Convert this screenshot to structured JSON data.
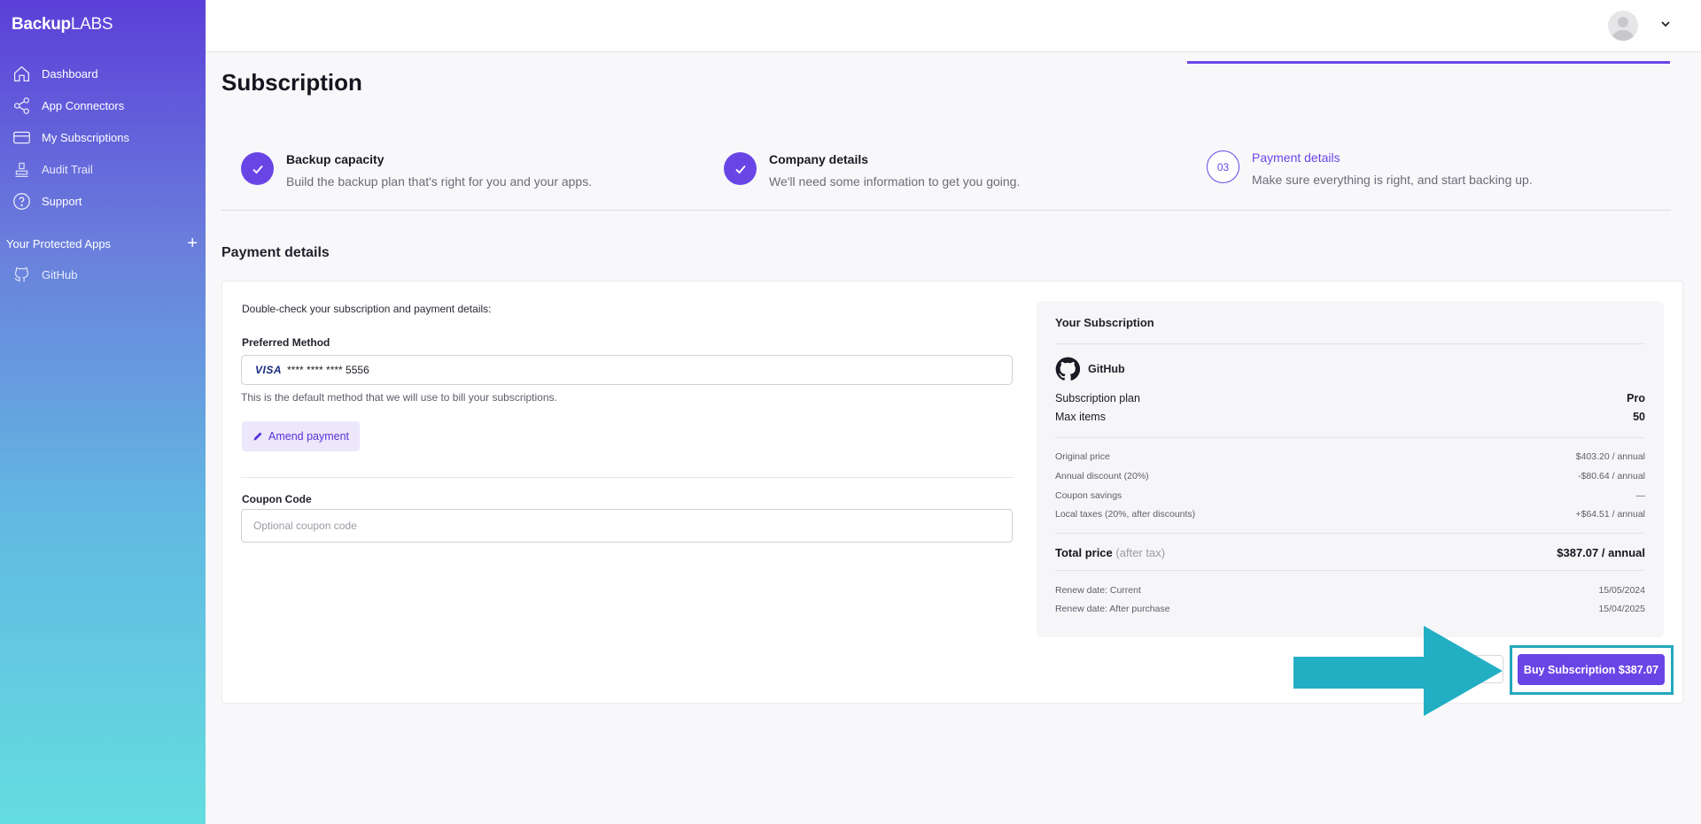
{
  "brand": {
    "bold": "Backup",
    "light": "LABS"
  },
  "sidebar": {
    "items": [
      {
        "label": "Dashboard",
        "icon": "home-icon"
      },
      {
        "label": "App Connectors",
        "icon": "share-nodes-icon"
      },
      {
        "label": "My Subscriptions",
        "icon": "credit-card-icon"
      },
      {
        "label": "Audit Trail",
        "icon": "stamp-icon"
      },
      {
        "label": "Support",
        "icon": "help-circle-icon"
      }
    ],
    "protected_apps_heading": "Your Protected Apps",
    "add_icon": "plus-icon",
    "protected_apps": [
      {
        "label": "GitHub",
        "icon": "github-icon"
      }
    ]
  },
  "page": {
    "title": "Subscription"
  },
  "stepper": {
    "steps": [
      {
        "title": "Backup capacity",
        "desc": "Build the backup plan that's right for you and your apps.",
        "state": "done"
      },
      {
        "title": "Company details",
        "desc": "We'll need some information to get you going.",
        "state": "done"
      },
      {
        "number": "03",
        "title": "Payment details",
        "desc": "Make sure everything is right, and start backing up.",
        "state": "current"
      }
    ]
  },
  "payment": {
    "section_title": "Payment details",
    "intro": "Double-check your subscription and payment details:",
    "preferred_label": "Preferred Method",
    "card_brand": "VISA",
    "card_number": "**** **** **** 5556",
    "help": "This is the default method that we will use to bill your subscriptions.",
    "amend_label": "Amend payment",
    "coupon_label": "Coupon Code",
    "coupon_placeholder": "Optional coupon code",
    "coupon_value": ""
  },
  "summary": {
    "title": "Your Subscription",
    "app": "GitHub",
    "plan_label": "Subscription plan",
    "plan_value": "Pro",
    "max_label": "Max items",
    "max_value": "50",
    "original_label": "Original price",
    "original_value": "$403.20 / annual",
    "discount_label": "Annual discount (20%)",
    "discount_value": "-$80.64 / annual",
    "coupon_label": "Coupon savings",
    "coupon_value": "—",
    "taxes_label": "Local taxes (20%, after discounts)",
    "taxes_value": "+$64.51 / annual",
    "total_label": "Total price",
    "total_note": "(after tax)",
    "total_value": "$387.07 / annual",
    "renew_current_label": "Renew date: Current",
    "renew_current_value": "15/05/2024",
    "renew_after_label": "Renew date: After purchase",
    "renew_after_value": "15/04/2025"
  },
  "actions": {
    "buy_label": "Buy Subscription $387.07"
  },
  "colors": {
    "accent": "#6a45e6",
    "highlight": "#22a8be",
    "arrow": "#22afc4"
  }
}
